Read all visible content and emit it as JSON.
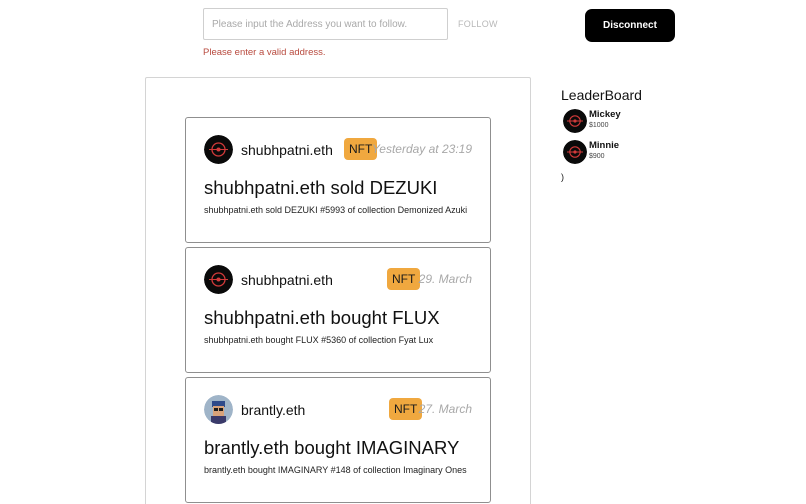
{
  "follow_form": {
    "placeholder": "Please input the Address you want to follow.",
    "value": "",
    "follow_label": "FOLLOW",
    "error": "Please enter a valid address."
  },
  "header": {
    "disconnect_label": "Disconnect"
  },
  "feed": [
    {
      "user": "shubhpatni.eth",
      "avatar": "ens-logo-avatar",
      "badge": "NFT",
      "time": "Yesterday at 23:19",
      "title": "shubhpatni.eth sold DEZUKI",
      "description": "shubhpatni.eth sold DEZUKI #5993 of collection Demonized Azuki"
    },
    {
      "user": "shubhpatni.eth",
      "avatar": "ens-logo-avatar",
      "badge": "NFT",
      "time": "29. March",
      "title": "shubhpatni.eth bought FLUX",
      "description": "shubhpatni.eth bought FLUX #5360 of collection Fyat Lux"
    },
    {
      "user": "brantly.eth",
      "avatar": "pixel-portrait-avatar",
      "badge": "NFT",
      "time": "27. March",
      "title": "brantly.eth bought IMAGINARY",
      "description": "brantly.eth bought IMAGINARY #148 of collection Imaginary Ones"
    }
  ],
  "leaderboard": {
    "title": "LeaderBoard",
    "entries": [
      {
        "name": "Mickey",
        "amount": "$1000",
        "avatar": "ens-logo-avatar"
      },
      {
        "name": "Minnie",
        "amount": "$900",
        "avatar": "ens-logo-avatar"
      }
    ],
    "trailing_text": ")"
  },
  "colors": {
    "badge": "#f0a83f",
    "error": "#b84a3e",
    "button": "#000000",
    "timestamp": "#a8a8a8"
  }
}
